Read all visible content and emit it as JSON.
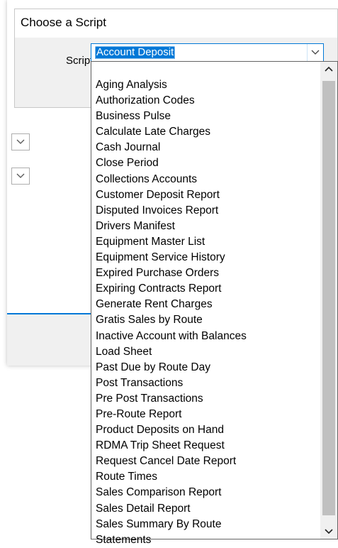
{
  "dialog": {
    "title": "Choose a Script",
    "script_label": "Script",
    "selected_value": "Account Deposit"
  },
  "dropdown": {
    "options": [
      "Aging Analysis",
      "Authorization Codes",
      "Business Pulse",
      "Calculate Late Charges",
      "Cash Journal",
      "Close Period",
      "Collections Accounts",
      "Customer Deposit Report",
      "Disputed Invoices Report",
      "Drivers Manifest",
      "Equipment Master List",
      "Equipment Service History",
      "Expired Purchase Orders",
      "Expiring Contracts Report",
      "Generate Rent Charges",
      "Gratis Sales by Route",
      "Inactive Account with Balances",
      "Load Sheet",
      "Past Due by Route Day",
      "Post Transactions",
      "Pre Post Transactions",
      "Pre-Route Report",
      "Product Deposits on Hand",
      "RDMA Trip Sheet Request",
      "Request Cancel Date Report",
      "Route Times",
      "Sales Comparison Report",
      "Sales Detail Report",
      "Sales Summary By Route",
      "Statements"
    ]
  },
  "icons": {
    "combo_arrow": "chevron-down-icon",
    "scroll_up": "chevron-up-icon",
    "scroll_down": "chevron-down-icon"
  },
  "colors": {
    "accent": "#0078d7",
    "selection_text": "#ffffff",
    "dialog_bg": "#f0f0f0"
  }
}
